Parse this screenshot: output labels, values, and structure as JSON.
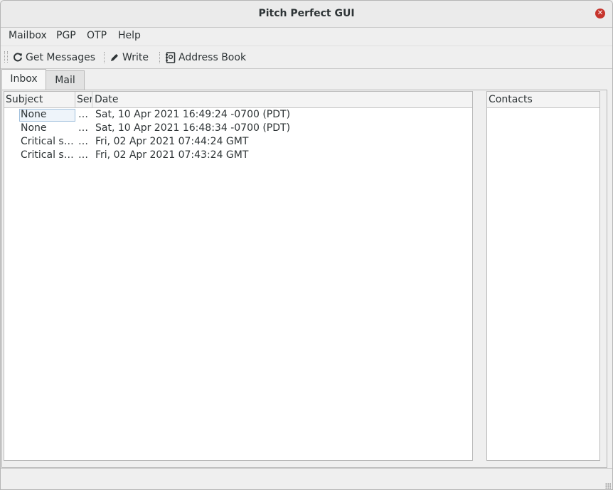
{
  "window": {
    "title": "Pitch Perfect GUI",
    "close_icon": "close-icon",
    "accent_color": "#c6342c"
  },
  "menubar": {
    "items": [
      {
        "label": "Mailbox"
      },
      {
        "label": "PGP"
      },
      {
        "label": "OTP"
      },
      {
        "label": "Help"
      }
    ]
  },
  "toolbar": {
    "get_messages": {
      "label": "Get Messages",
      "icon": "refresh-icon"
    },
    "write": {
      "label": "Write",
      "icon": "pencil-icon"
    },
    "address_book": {
      "label": "Address Book",
      "icon": "address-book-icon"
    }
  },
  "tabs": [
    {
      "label": "Inbox",
      "active": true
    },
    {
      "label": "Mail",
      "active": false
    }
  ],
  "inbox": {
    "columns": [
      "Subject",
      "Ser",
      "Date"
    ],
    "rows": [
      {
        "subject": "None",
        "sender": "…",
        "date": "Sat, 10 Apr 2021 16:49:24 -0700 (PDT)",
        "focused": true
      },
      {
        "subject": "None",
        "sender": "…",
        "date": "Sat, 10 Apr 2021 16:48:34 -0700 (PDT)",
        "focused": false
      },
      {
        "subject": "Critical s…",
        "sender": "…",
        "date": "Fri, 02 Apr 2021 07:44:24 GMT",
        "focused": false
      },
      {
        "subject": "Critical s…",
        "sender": "…",
        "date": "Fri, 02 Apr 2021 07:43:24 GMT",
        "focused": false
      }
    ]
  },
  "contacts": {
    "header": "Contacts",
    "items": []
  },
  "statusbar": {
    "text": ""
  }
}
